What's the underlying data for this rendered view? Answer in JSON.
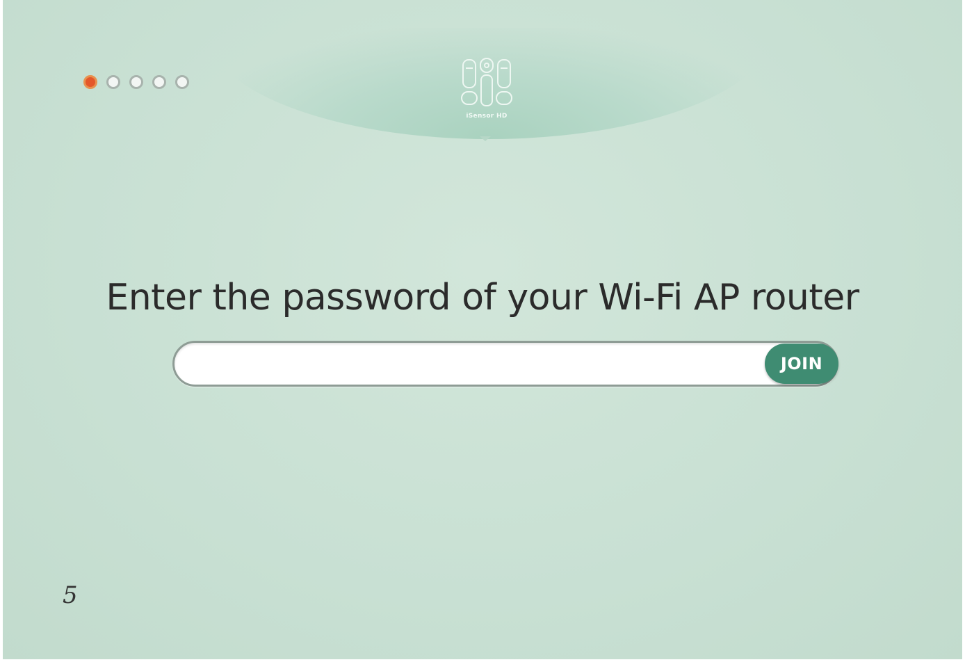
{
  "header": {
    "steps": [
      {
        "state": "active"
      },
      {
        "state": "inactive"
      },
      {
        "state": "inactive"
      },
      {
        "state": "inactive"
      },
      {
        "state": "inactive"
      }
    ],
    "logo": {
      "icon": "devices-icon",
      "caption": "iSensor HD"
    }
  },
  "main": {
    "heading": "Enter the password of your Wi-Fi AP router",
    "password_field": {
      "value": "",
      "placeholder": ""
    },
    "join_label": "JOIN"
  },
  "footer": {
    "page_number": "5"
  },
  "colors": {
    "background": "#c8e0d3",
    "accent": "#3f8c72",
    "active_step": "#e4572a"
  }
}
